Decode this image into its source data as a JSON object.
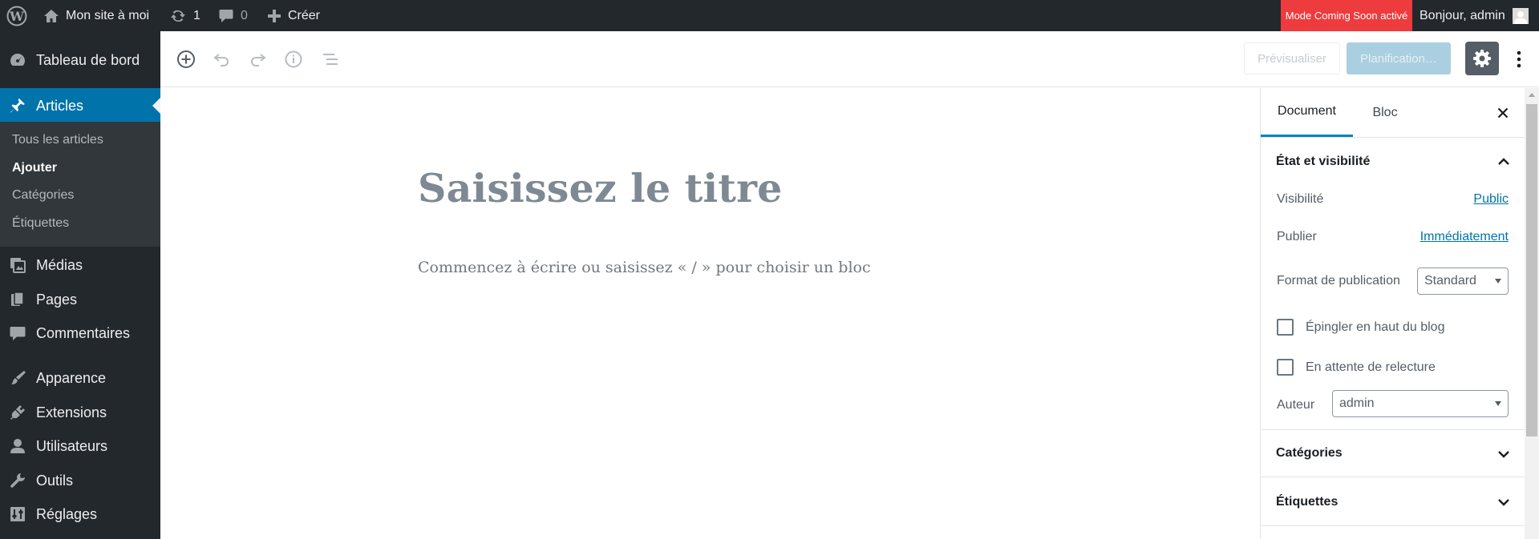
{
  "adminbar": {
    "site_name": "Mon site à moi",
    "updates_count": "1",
    "comments_count": "0",
    "new_label": "Créer",
    "coming_soon": "Mode Coming Soon activé",
    "greeting": "Bonjour, admin"
  },
  "sidebar": {
    "dashboard": "Tableau de bord",
    "articles": "Articles",
    "submenu": [
      "Tous les articles",
      "Ajouter",
      "Catégories",
      "Étiquettes"
    ],
    "media": "Médias",
    "pages": "Pages",
    "comments": "Commentaires",
    "appearance": "Apparence",
    "plugins": "Extensions",
    "users": "Utilisateurs",
    "tools": "Outils",
    "settings": "Réglages"
  },
  "header": {
    "preview_label": "Prévisualiser",
    "schedule_label": "Planification…"
  },
  "editor": {
    "title_placeholder": "Saisissez le titre",
    "body_placeholder": "Commencez à écrire ou saisissez « / » pour choisir un bloc"
  },
  "settings_panel": {
    "tabs": [
      "Document",
      "Bloc"
    ],
    "status_title": "État et visibilité",
    "visibility_label": "Visibilité",
    "visibility_value": "Public",
    "publish_label": "Publier",
    "publish_value": "Immédiatement",
    "format_label": "Format de publication",
    "format_value": "Standard",
    "sticky_label": "Épingler en haut du blog",
    "pending_label": "En attente de relecture",
    "author_label": "Auteur",
    "author_value": "admin",
    "categories_title": "Catégories",
    "tags_title": "Étiquettes"
  },
  "colors": {
    "adminbar_bg": "#23282d",
    "accent": "#0073aa",
    "coming_soon_bg": "#ed3b3e"
  }
}
